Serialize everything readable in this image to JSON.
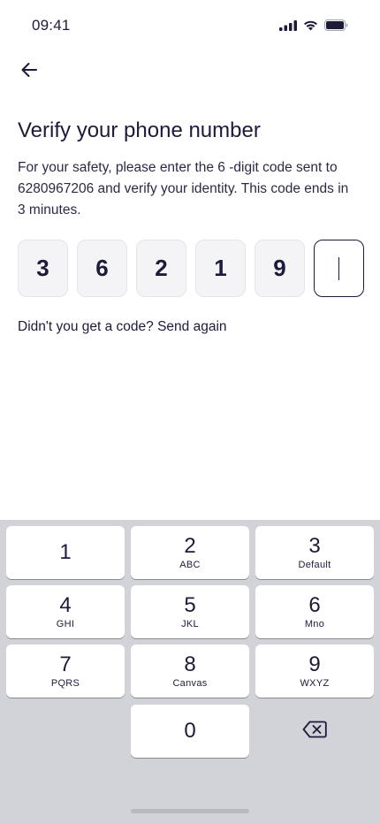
{
  "status_bar": {
    "time": "09:41",
    "icons": [
      "signal-icon",
      "wifi-icon",
      "battery-icon"
    ]
  },
  "header": {
    "back_icon": "arrow-left-icon"
  },
  "main": {
    "title": "Verify your phone number",
    "description": "For your safety, please enter the 6 -digit code sent to 6280967206 and verify your identity. This code ends in 3 minutes.",
    "otp_digits": [
      "3",
      "6",
      "2",
      "1",
      "9",
      ""
    ],
    "resend_prompt": "Didn't you get a code?",
    "resend_link": "Send again"
  },
  "keypad": {
    "keys": [
      {
        "num": "1",
        "sub": ""
      },
      {
        "num": "2",
        "sub": "ABC"
      },
      {
        "num": "3",
        "sub": "Default"
      },
      {
        "num": "4",
        "sub": "GHI"
      },
      {
        "num": "5",
        "sub": "JKL"
      },
      {
        "num": "6",
        "sub": "Mno"
      },
      {
        "num": "7",
        "sub": "PQRS"
      },
      {
        "num": "8",
        "sub": "Canvas"
      },
      {
        "num": "9",
        "sub": "WXYZ"
      },
      {
        "num": "0",
        "sub": ""
      }
    ],
    "delete_icon": "backspace-icon"
  },
  "colors": {
    "text": "#1c1b3a",
    "keypad_bg": "#d1d3d9",
    "otp_bg": "#f4f4f6"
  }
}
